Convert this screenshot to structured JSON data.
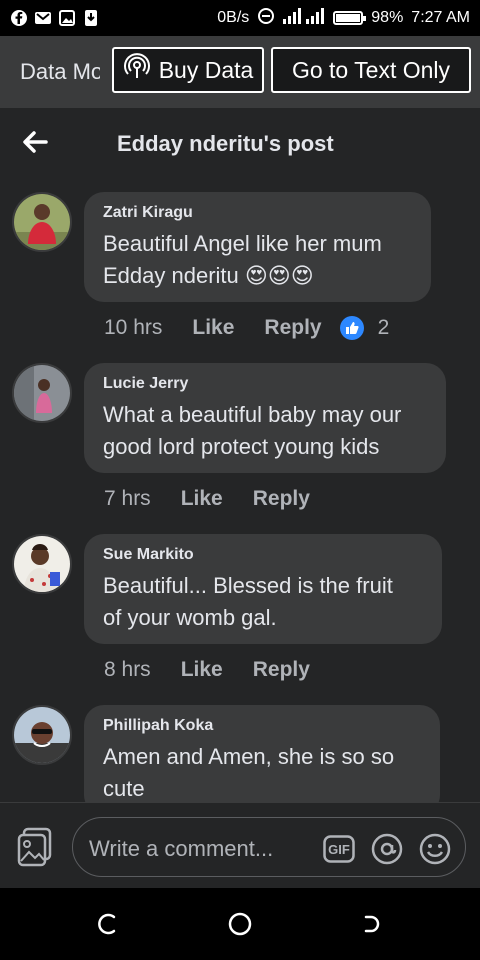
{
  "status": {
    "network_speed": "0B/s",
    "battery": "98%",
    "battery_level": 0.98,
    "time": "7:27 AM"
  },
  "databar": {
    "label": "Data Mo",
    "buy_label": "Buy Data",
    "text_only_label": "Go to Text Only"
  },
  "header": {
    "title": "Edday nderitu's post"
  },
  "comments": [
    {
      "author": "Zatri Kiragu",
      "line1": "Beautiful Angel like her mum",
      "line2": "Edday nderitu 😍😍😍",
      "time": "10 hrs",
      "like": "Like",
      "reply": "Reply",
      "reactions": "2"
    },
    {
      "author": "Lucie Jerry",
      "line1": "What a beautiful baby may our",
      "line2": "good lord protect young kids",
      "time": "7 hrs",
      "like": "Like",
      "reply": "Reply"
    },
    {
      "author": "Sue Markito",
      "line1": "Beautiful... Blessed is the fruit",
      "line2": "of your womb gal.",
      "time": "8 hrs",
      "like": "Like",
      "reply": "Reply"
    },
    {
      "author": "Phillipah Koka",
      "line1": "Amen and Amen, she is so so",
      "line2": "cute"
    }
  ],
  "composer": {
    "placeholder": "Write a comment...",
    "gif": "GIF"
  },
  "colors": {
    "background": "#18191a",
    "surface": "#242526",
    "bubble": "#3a3b3c",
    "accent_blue": "#2d88ff"
  }
}
